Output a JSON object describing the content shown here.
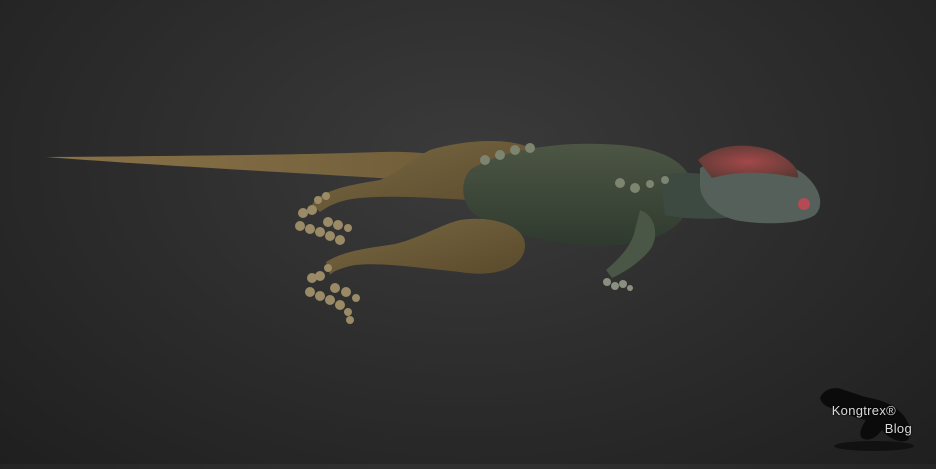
{
  "image": {
    "subject": "dinosaur-render",
    "background_color": "#2e2e2e"
  },
  "watermark": {
    "line1": "Kongtrex®",
    "line2": "Blog",
    "silhouette_icon": "trex-silhouette-icon"
  },
  "colors": {
    "body_dark": "#3f4a3a",
    "body_olive": "#6b5c3a",
    "tail": "#8a7146",
    "head_red": "#8a3b3b"
  }
}
